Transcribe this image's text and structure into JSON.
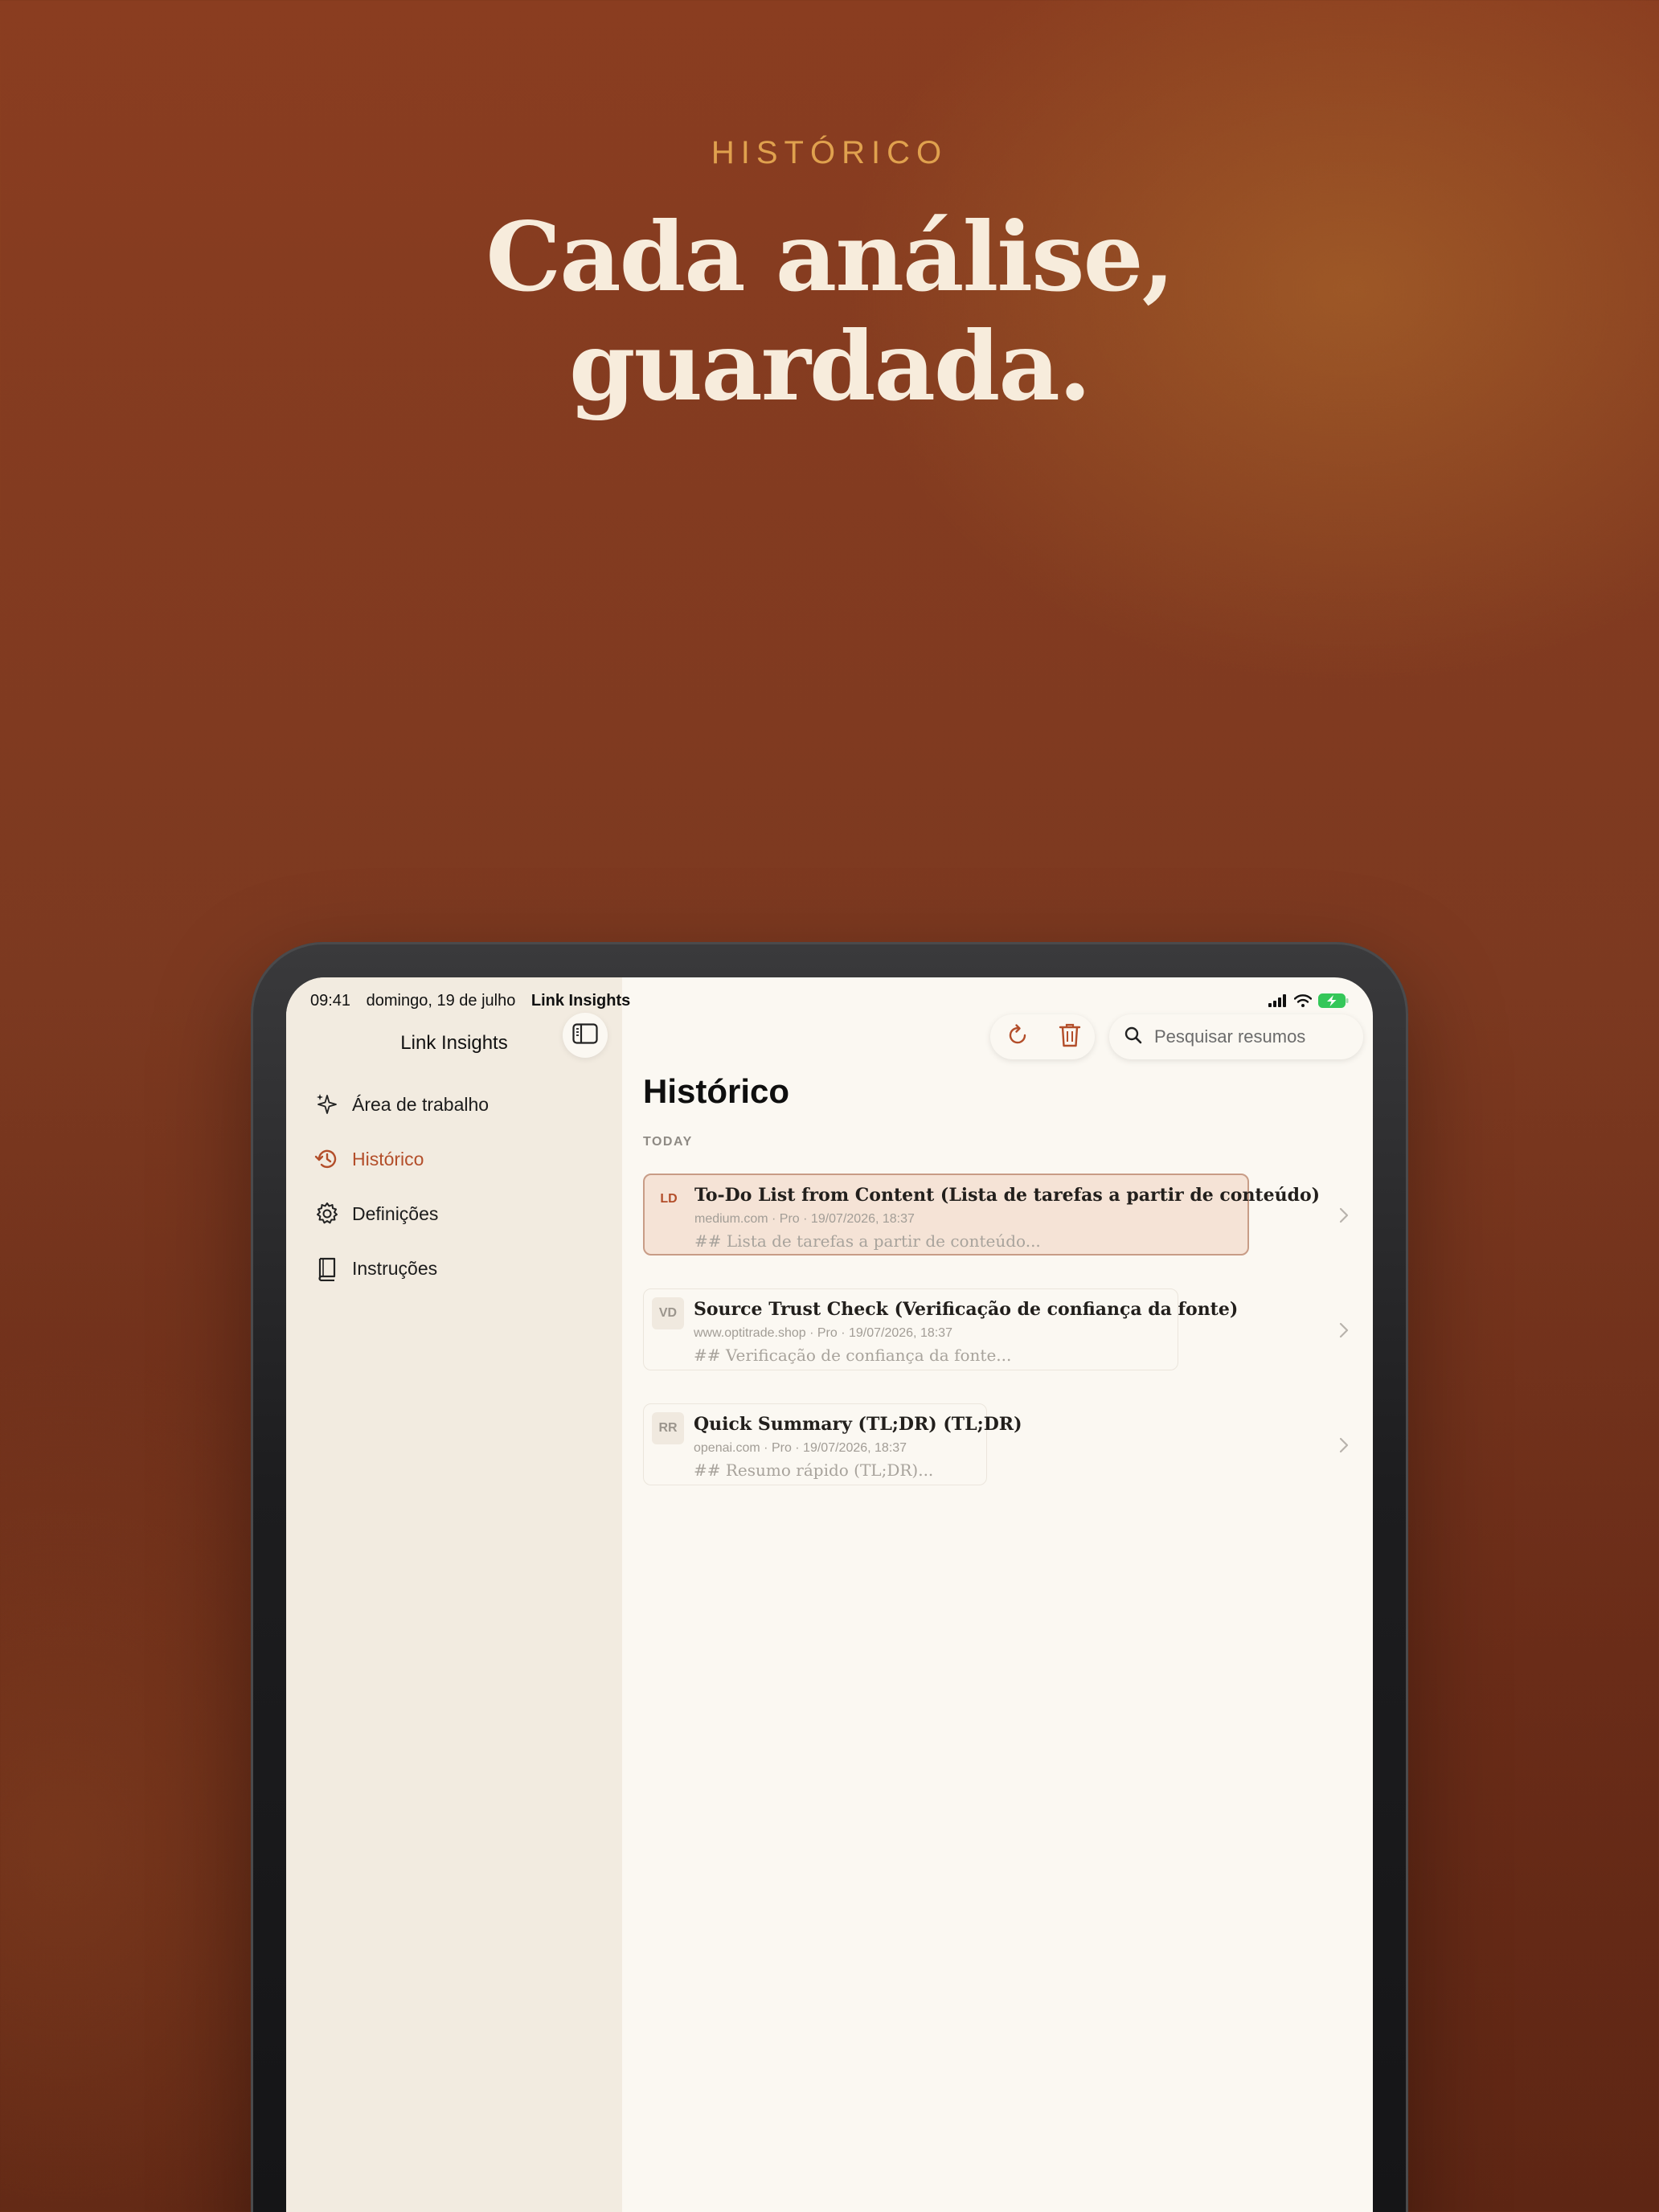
{
  "hero": {
    "eyebrow": "HISTÓRICO",
    "headline_line1": "Cada análise,",
    "headline_line2": "guardada."
  },
  "status_bar": {
    "time": "09:41",
    "date": "domingo, 19 de julho",
    "app": "Link Insights",
    "battery_color": "#34c759"
  },
  "sidebar": {
    "title": "Link Insights",
    "items": [
      {
        "label": "Área de trabalho",
        "icon": "sparkles-icon",
        "active": false
      },
      {
        "label": "Histórico",
        "icon": "history-icon",
        "active": true
      },
      {
        "label": "Definições",
        "icon": "gear-icon",
        "active": false
      },
      {
        "label": "Instruções",
        "icon": "book-icon",
        "active": false
      }
    ]
  },
  "toolbar": {
    "search_placeholder": "Pesquisar resumos"
  },
  "main": {
    "title": "Histórico",
    "section": "TODAY",
    "entries": [
      {
        "badge": "LD",
        "title": "To-Do List from Content (Lista de tarefas a partir de conteúdo)",
        "meta": "medium.com · Pro · 19/07/2026, 18:37",
        "preview": "## Lista de tarefas a partir de conteúdo...",
        "selected": true
      },
      {
        "badge": "VD",
        "title": "Source Trust Check (Verificação de confiança da fonte)",
        "meta": "www.optitrade.shop · Pro · 19/07/2026, 18:37",
        "preview": "## Verificação de confiança da fonte...",
        "selected": false
      },
      {
        "badge": "RR",
        "title": "Quick Summary (TL;DR) (TL;DR)",
        "meta": "openai.com · Pro · 19/07/2026, 18:37",
        "preview": "## Resumo rápido (TL;DR)...",
        "selected": false
      }
    ]
  },
  "colors": {
    "accent": "#b34e2a",
    "eyebrow": "#e0a14e",
    "hero_text": "#f7ecdc"
  }
}
